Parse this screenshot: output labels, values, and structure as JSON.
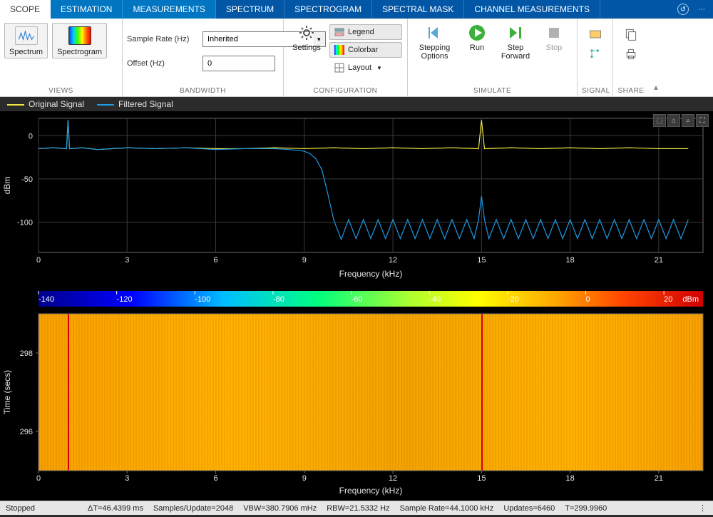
{
  "tabs": {
    "items": [
      {
        "label": "SCOPE",
        "active": true
      },
      {
        "label": "ESTIMATION"
      },
      {
        "label": "MEASUREMENTS"
      },
      {
        "label": "SPECTRUM"
      },
      {
        "label": "SPECTROGRAM"
      },
      {
        "label": "SPECTRAL MASK"
      },
      {
        "label": "CHANNEL MEASUREMENTS"
      }
    ]
  },
  "ribbon": {
    "views": {
      "label": "VIEWS",
      "spectrum": "Spectrum",
      "spectrogram": "Spectrogram"
    },
    "bandwidth": {
      "label": "BANDWIDTH",
      "sample_rate_label": "Sample Rate (Hz)",
      "sample_rate_value": "Inherited",
      "offset_label": "Offset (Hz)",
      "offset_value": "0"
    },
    "configuration": {
      "label": "CONFIGURATION",
      "settings": "Settings",
      "legend": "Legend",
      "colorbar": "Colorbar",
      "layout": "Layout"
    },
    "simulate": {
      "label": "SIMULATE",
      "stepping": "Stepping Options",
      "run": "Run",
      "step_fwd": "Step Forward",
      "stop": "Stop"
    },
    "signal": {
      "label": "SIGNAL"
    },
    "share": {
      "label": "SHARE"
    }
  },
  "legend": {
    "original": "Original Signal",
    "filtered": "Filtered Signal"
  },
  "spectrum": {
    "xlabel": "Frequency (kHz)",
    "ylabel": "dBm",
    "xticks": [
      "0",
      "3",
      "6",
      "9",
      "12",
      "15",
      "18",
      "21"
    ],
    "yticks": [
      "0",
      "-50",
      "-100"
    ]
  },
  "spectrogram": {
    "xlabel": "Frequency (kHz)",
    "ylabel": "Time (secs)",
    "xticks": [
      "0",
      "3",
      "6",
      "9",
      "12",
      "15",
      "18",
      "21"
    ],
    "yticks": [
      "298",
      "296"
    ],
    "colorbar": {
      "unit": "dBm",
      "ticks": [
        "-140",
        "-120",
        "-100",
        "-80",
        "-60",
        "-40",
        "-20",
        "0",
        "20"
      ]
    }
  },
  "status": {
    "state": "Stopped",
    "dt": "ΔT=46.4399 ms",
    "spu": "Samples/Update=2048",
    "vbw": "VBW=380.7906 mHz",
    "rbw": "RBW=21.5332 Hz",
    "srate": "Sample Rate=44.1000 kHz",
    "updates": "Updates=6460",
    "t": "T=299.9960"
  },
  "chart_data": [
    {
      "type": "line",
      "title": "Spectrum",
      "xlabel": "Frequency (kHz)",
      "ylabel": "dBm",
      "xlim": [
        0,
        22.5
      ],
      "ylim": [
        -135,
        20
      ],
      "series": [
        {
          "name": "Original Signal",
          "color": "#f0e442",
          "x": [
            0,
            0.5,
            0.95,
            1.0,
            1.05,
            1.5,
            2,
            3,
            4,
            5,
            6,
            7,
            8,
            9,
            10,
            11,
            12,
            13,
            14,
            14.9,
            15.0,
            15.1,
            16,
            17,
            18,
            19,
            20,
            21,
            22
          ],
          "y": [
            -15,
            -14,
            -15,
            18,
            -15,
            -14,
            -16,
            -14,
            -15,
            -14,
            -15,
            -15,
            -14,
            -15,
            -14,
            -15,
            -14,
            -15,
            -14,
            -15,
            18,
            -15,
            -14,
            -15,
            -14,
            -15,
            -14,
            -15,
            -15
          ]
        },
        {
          "name": "Filtered Signal",
          "color": "#1c9be8",
          "x": [
            0,
            0.5,
            0.95,
            1.0,
            1.05,
            1.5,
            2,
            3,
            4,
            5,
            6,
            7,
            8,
            8.5,
            9,
            9.2,
            9.4,
            9.6,
            9.8,
            10,
            10.25,
            10.5,
            10.75,
            11,
            11.25,
            11.5,
            11.75,
            12,
            12.25,
            12.5,
            12.75,
            13,
            13.25,
            13.5,
            13.75,
            14,
            14.25,
            14.5,
            14.75,
            14.9,
            15.0,
            15.1,
            15.25,
            15.5,
            15.75,
            16,
            16.25,
            16.5,
            16.75,
            17,
            17.25,
            17.5,
            17.75,
            18,
            18.25,
            18.5,
            18.75,
            19,
            19.25,
            19.5,
            19.75,
            20,
            20.25,
            20.5,
            20.75,
            21,
            21.25,
            21.5,
            21.75,
            22
          ],
          "y": [
            -15,
            -14,
            -15,
            18,
            -15,
            -14,
            -16,
            -14,
            -15,
            -14,
            -16,
            -15,
            -15,
            -16,
            -18,
            -21,
            -27,
            -40,
            -68,
            -98,
            -120,
            -97,
            -119,
            -97,
            -119,
            -97,
            -119,
            -97,
            -119,
            -97,
            -119,
            -97,
            -119,
            -97,
            -119,
            -97,
            -119,
            -97,
            -119,
            -97,
            -70,
            -97,
            -119,
            -97,
            -119,
            -97,
            -119,
            -97,
            -119,
            -97,
            -119,
            -97,
            -119,
            -97,
            -119,
            -97,
            -119,
            -97,
            -119,
            -97,
            -119,
            -97,
            -119,
            -97,
            -119,
            -97,
            -119,
            -97,
            -119,
            -97
          ]
        }
      ]
    },
    {
      "type": "heatmap",
      "title": "Spectrogram",
      "xlabel": "Frequency (kHz)",
      "ylabel": "Time (secs)",
      "xlim": [
        0,
        22.5
      ],
      "ylim": [
        295,
        299
      ],
      "colorbar": {
        "unit": "dBm",
        "min": -140,
        "max": 30
      },
      "features": {
        "tone_lines_khz": [
          1,
          15
        ],
        "tone_value_dbm": 18,
        "background_value_dbm": -15
      }
    }
  ]
}
